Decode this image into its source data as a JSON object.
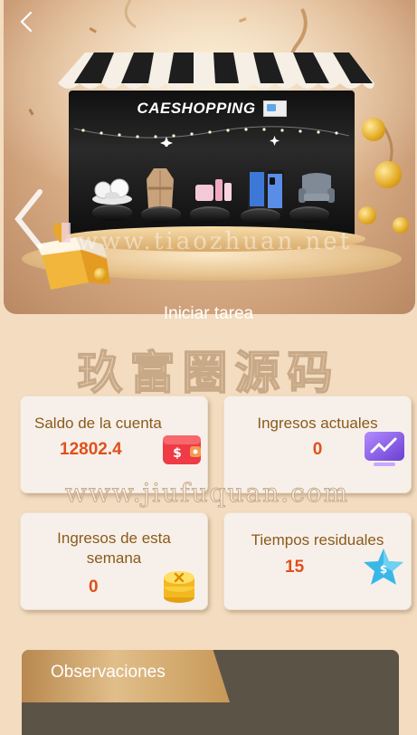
{
  "nav": {
    "back_icon": "chevron-left-icon"
  },
  "banner": {
    "store_name": "CAESHOPPING",
    "watermark": "www.tiaozhuan.net",
    "prev_icon": "chevron-left-icon"
  },
  "start_task_label": "Iniciar tarea",
  "brand_watermark": "玖富圈源码",
  "url_watermark": "www.jiufuquan.com",
  "cards": {
    "balance": {
      "label": "Saldo de la cuenta",
      "value": "12802.4",
      "icon": "wallet-icon",
      "color": "#e0501a"
    },
    "current_income": {
      "label": "Ingresos actuales",
      "value": "0",
      "icon": "chart-icon"
    },
    "weekly_income": {
      "label": "Ingresos de esta semana",
      "value": "0",
      "icon": "coins-icon"
    },
    "remaining_times": {
      "label": "Tiempos residuales",
      "value": "15",
      "icon": "star-dollar-icon"
    }
  },
  "observations": {
    "title": "Observaciones"
  }
}
